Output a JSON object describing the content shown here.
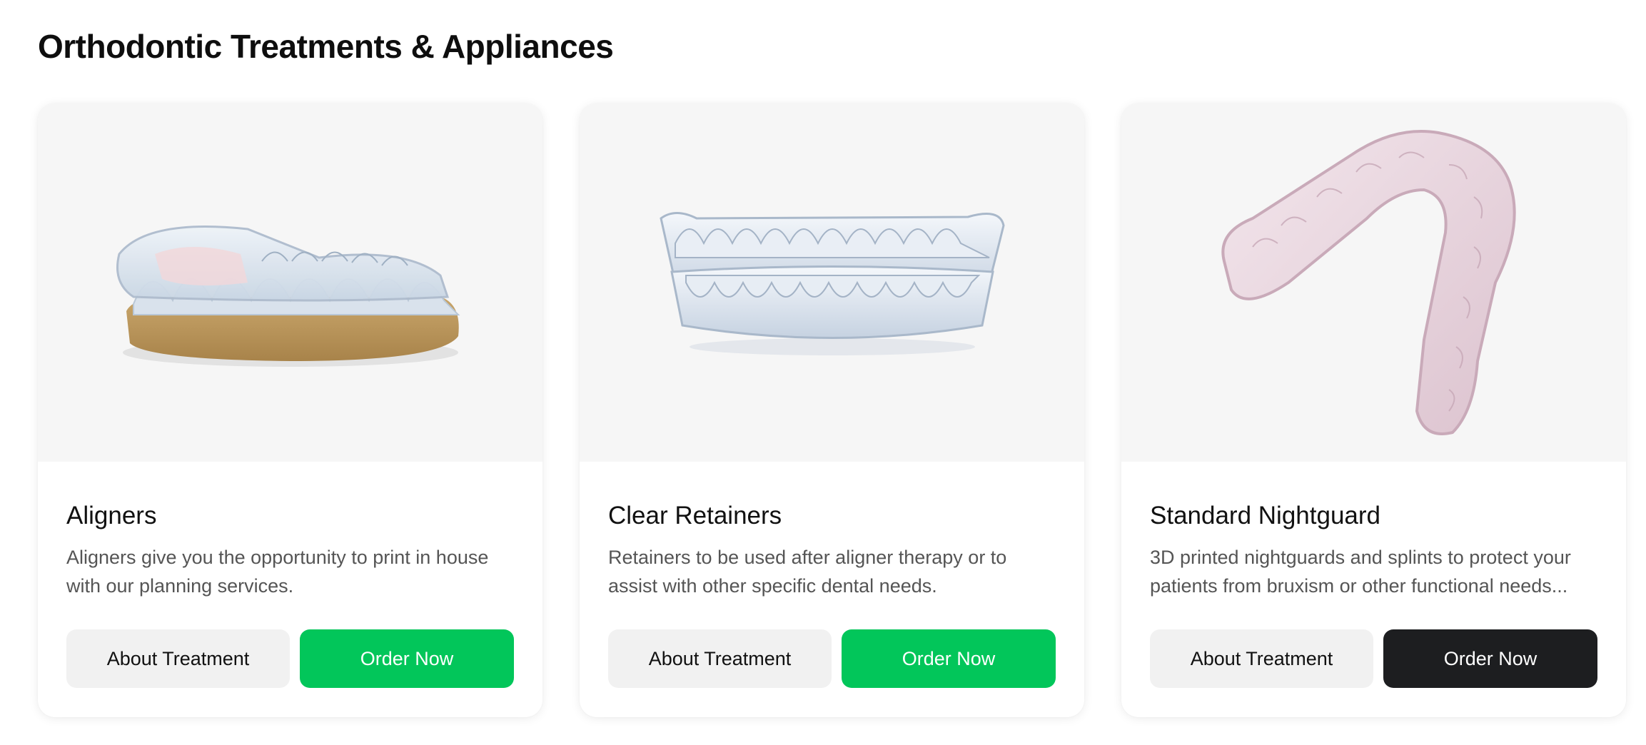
{
  "page": {
    "title": "Orthodontic Treatments & Appliances"
  },
  "cards": [
    {
      "title": "Aligners",
      "description": "Aligners give you the opportunity to print in house with our planning services.",
      "image_icon": "aligner-on-model-image",
      "about_label": "About Treatment",
      "order_label": "Order Now",
      "order_color": "#02c65a"
    },
    {
      "title": "Clear Retainers",
      "description": "Retainers to be used after aligner therapy or to assist with other specific dental needs.",
      "image_icon": "clear-retainers-image",
      "about_label": "About Treatment",
      "order_label": "Order Now",
      "order_color": "#02c65a"
    },
    {
      "title": "Standard Nightguard",
      "description": "3D printed nightguards and splints to protect your patients from bruxism or other functional needs...",
      "image_icon": "nightguard-image",
      "about_label": "About Treatment",
      "order_label": "Order Now",
      "order_color": "#1d1e20"
    }
  ],
  "colors": {
    "accent_green": "#02c65a",
    "dark_button": "#1d1e20",
    "secondary_button": "#f1f1f1",
    "media_background": "#f6f6f6"
  }
}
